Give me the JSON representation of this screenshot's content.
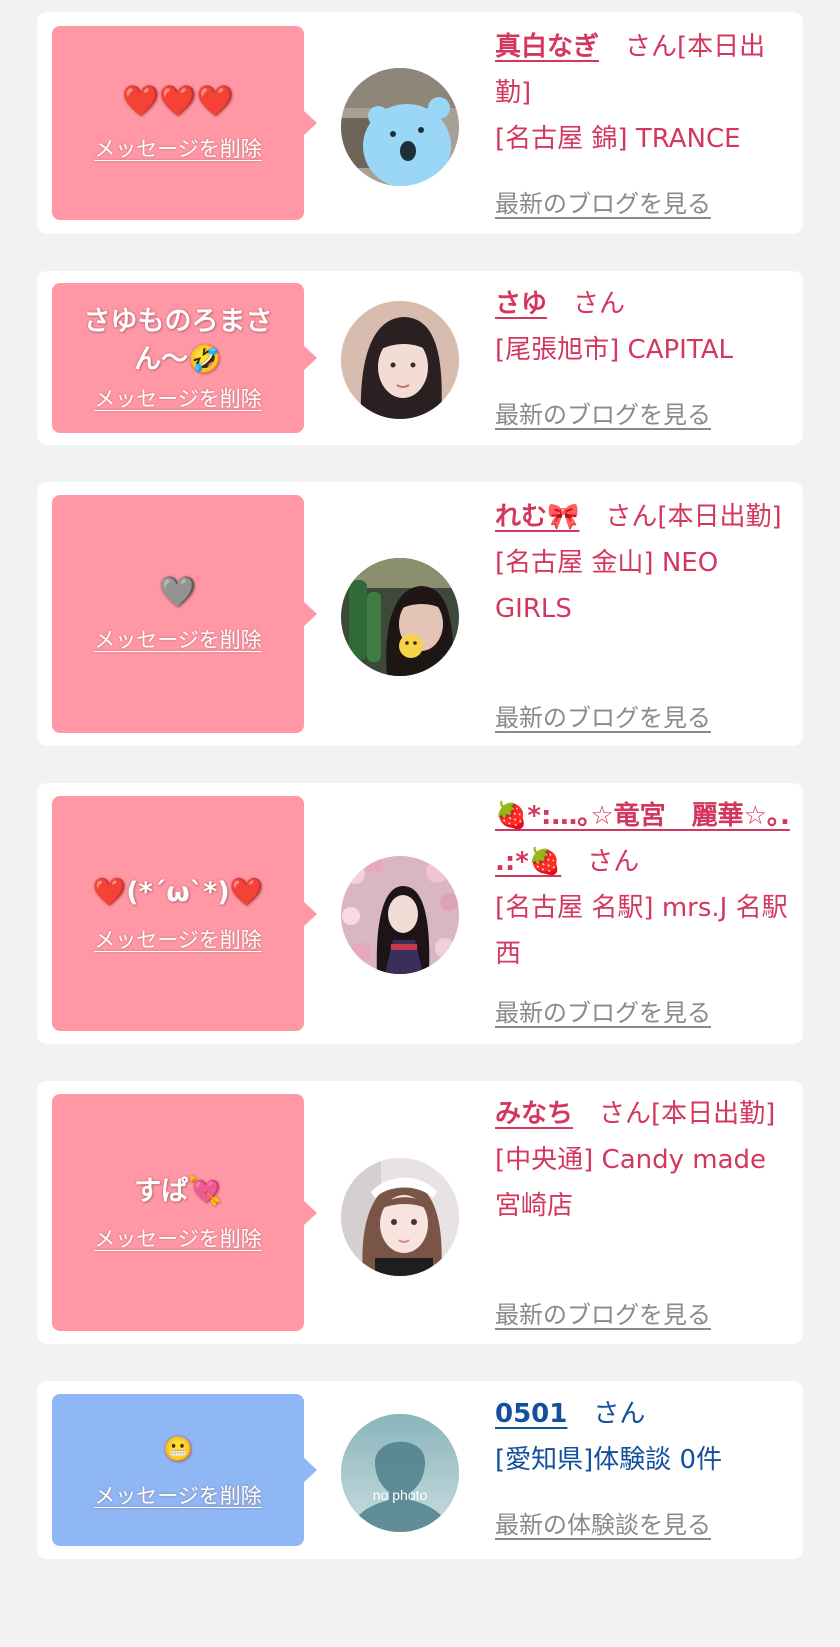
{
  "cards": [
    {
      "message": "❤️❤️❤️",
      "delete_label": "メッセージを削除",
      "avatar": "blue-bear-face",
      "name": "真白なぎ",
      "suffix": "さん[本日出勤]",
      "shop": "[名古屋 錦] TRANCE",
      "blog_link": "最新のブログを見る"
    },
    {
      "message": "さゆものろまさん〜🤣",
      "delete_label": "メッセージを削除",
      "avatar": "woman-portrait",
      "name": "さゆ",
      "suffix": "さん",
      "shop": "[尾張旭市] CAPITAL",
      "blog_link": "最新のブログを見る"
    },
    {
      "message": "🩶",
      "delete_label": "メッセージを削除",
      "avatar": "woman-with-bottles",
      "name": "れむ🎀",
      "suffix": "さん[本日出勤]",
      "shop": "[名古屋 金山] NEO GIRLS",
      "blog_link": "最新のブログを見る"
    },
    {
      "message": "❤️(*´ω`*)❤️",
      "delete_label": "メッセージを削除",
      "avatar": "woman-kimono-blossoms",
      "name": "🍓*:…｡☆竜宮　麗華☆｡. .:*🍓",
      "suffix": "さん",
      "shop": "[名古屋 名駅] mrs.J 名駅西",
      "blog_link": "最新のブログを見る"
    },
    {
      "message": "すぱ💘",
      "delete_label": "メッセージを削除",
      "avatar": "woman-maid-headband",
      "name": "みなち",
      "suffix": "さん[本日出勤]",
      "shop": "[中央通] Candy made 宮崎店",
      "blog_link": "最新のブログを見る"
    },
    {
      "message": "😬",
      "delete_label": "メッセージを削除",
      "avatar": "no-photo-silhouette",
      "avatar_text": "no photo",
      "name": "0501",
      "suffix": "さん",
      "shop": "[愛知県]体験談 0件",
      "blog_link": "最新の体験談を見る"
    }
  ],
  "colors": {
    "page_bg": "#f2f2f2",
    "pink_bubble": "#ff97a5",
    "blue_bubble": "#8fb6f5",
    "pink_text": "#d4375e",
    "blue_text": "#124f9d",
    "link_gray": "#8a8a8a"
  }
}
